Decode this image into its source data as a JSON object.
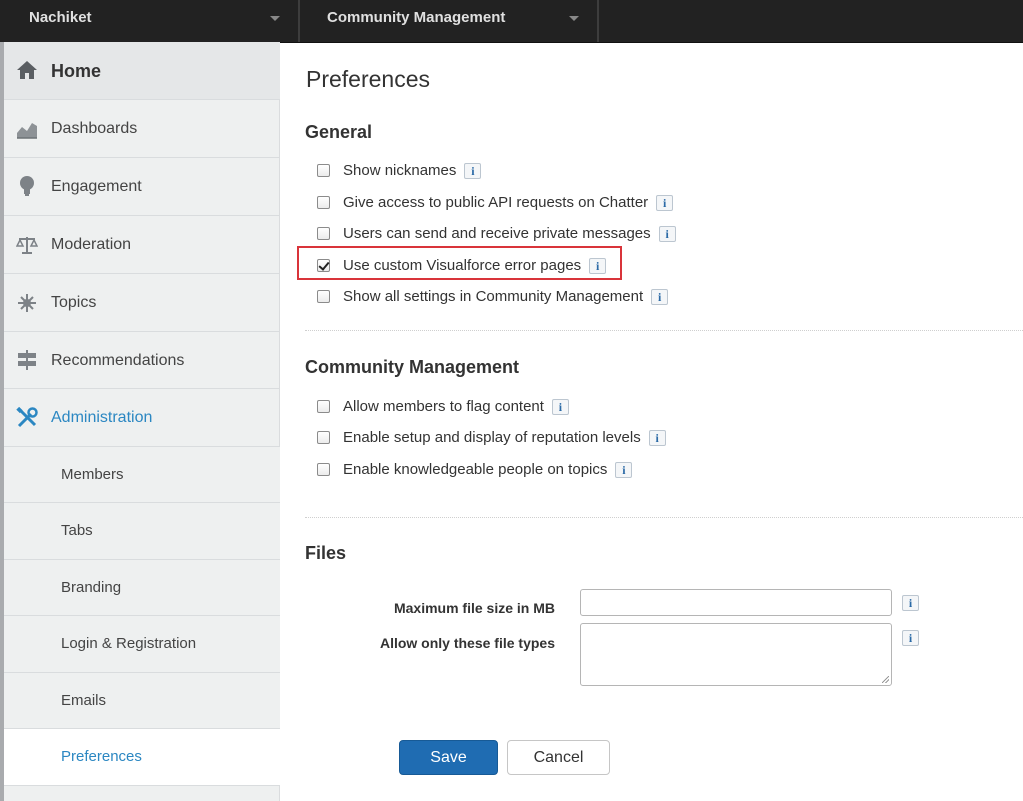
{
  "topbar": {
    "user_menu": "Nachiket",
    "app_menu": "Community Management"
  },
  "sidebar": {
    "items": [
      {
        "label": "Home",
        "icon": "home-icon"
      },
      {
        "label": "Dashboards",
        "icon": "chart-icon"
      },
      {
        "label": "Engagement",
        "icon": "lightbulb-icon"
      },
      {
        "label": "Moderation",
        "icon": "scales-icon"
      },
      {
        "label": "Topics",
        "icon": "starburst-icon"
      },
      {
        "label": "Recommendations",
        "icon": "signpost-icon"
      },
      {
        "label": "Administration",
        "icon": "tools-icon"
      }
    ],
    "admin_subitems": [
      "Members",
      "Tabs",
      "Branding",
      "Login & Registration",
      "Emails",
      "Preferences"
    ]
  },
  "main": {
    "title": "Preferences",
    "general": {
      "heading": "General",
      "options": [
        {
          "label": "Show nicknames",
          "checked": false
        },
        {
          "label": "Give access to public API requests on Chatter",
          "checked": false
        },
        {
          "label": "Users can send and receive private messages",
          "checked": false
        },
        {
          "label": "Use custom Visualforce error pages",
          "checked": true
        },
        {
          "label": "Show all settings in Community Management",
          "checked": false
        }
      ]
    },
    "community_management": {
      "heading": "Community Management",
      "options": [
        {
          "label": "Allow members to flag content",
          "checked": false
        },
        {
          "label": "Enable setup and display of reputation levels",
          "checked": false
        },
        {
          "label": "Enable knowledgeable people on topics",
          "checked": false
        }
      ]
    },
    "files": {
      "heading": "Files",
      "max_size_label": "Maximum file size in MB",
      "max_size_value": "",
      "file_types_label": "Allow only these file types",
      "file_types_value": ""
    },
    "info_glyph": "i",
    "save_label": "Save",
    "cancel_label": "Cancel"
  },
  "colors": {
    "accent": "#2b87c2",
    "primary_button": "#1f6cb2",
    "highlight_box": "#d9343a",
    "topbar": "#222222"
  }
}
